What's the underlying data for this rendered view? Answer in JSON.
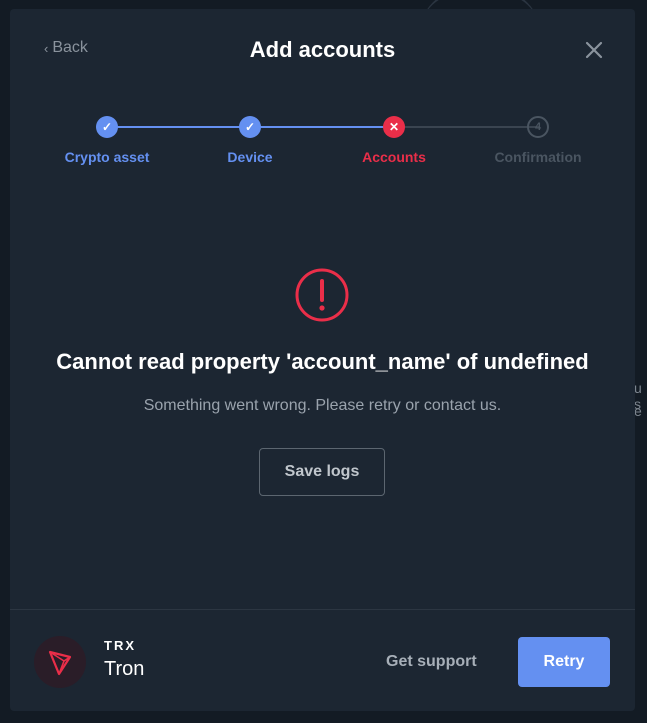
{
  "header": {
    "back_label": "Back",
    "title": "Add accounts"
  },
  "stepper": {
    "steps": [
      {
        "label": "Crypto asset",
        "status": "done",
        "marker": "✓"
      },
      {
        "label": "Device",
        "status": "done",
        "marker": "✓"
      },
      {
        "label": "Accounts",
        "status": "error",
        "marker": "✕"
      },
      {
        "label": "Confirmation",
        "status": "pending",
        "marker": "4"
      }
    ]
  },
  "error": {
    "title": "Cannot read property 'account_name' of undefined",
    "subtitle": "Something went wrong. Please retry or contact us.",
    "save_logs_label": "Save logs"
  },
  "footer": {
    "coin_ticker": "TRX",
    "coin_name": "Tron",
    "get_support_label": "Get support",
    "retry_label": "Retry"
  },
  "background": {
    "partial_text_1": "u s",
    "partial_text_2": "e"
  },
  "colors": {
    "accent": "#6490f1",
    "error": "#ea2e49",
    "modal_bg": "#1c2632",
    "page_bg": "#131b24"
  }
}
